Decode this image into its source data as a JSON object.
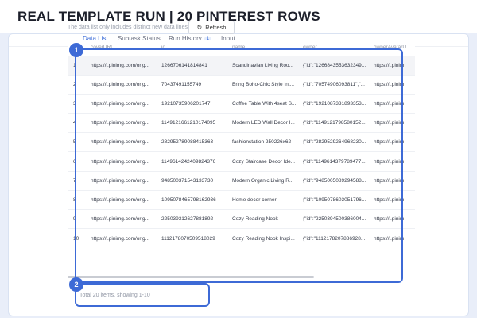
{
  "banner": {
    "title": "REAL TEMPLATE RUN  |  20 PINTEREST ROWS"
  },
  "tabs": [
    {
      "label": "Data List",
      "active": true
    },
    {
      "label": "Subtask Status",
      "active": false
    },
    {
      "label": "Run History",
      "active": false,
      "badge": "1"
    },
    {
      "label": "Input",
      "active": false
    }
  ],
  "toolbar": {
    "info": "The data list only includes distinct new data lines",
    "refresh_label": "Refresh",
    "refresh_icon": "refresh-icon"
  },
  "table": {
    "headers": [
      "#",
      "coverURL",
      "id",
      "name",
      "owner",
      "ownerAvatarU"
    ],
    "rows": [
      [
        "1",
        "https://i.pinimg.com/orig...",
        "1266706141814841",
        "Scandinavian Living Roo...",
        "{\"id\":\"1266843553632349...",
        "https://i.pinim"
      ],
      [
        "2",
        "https://i.pinimg.com/orig...",
        "70437491155749",
        "Bring Boho-Chic Style Int...",
        "{\"id\":\"70574906093811\",\"...",
        "https://i.pinim"
      ],
      [
        "3",
        "https://i.pinimg.com/orig...",
        "19210735906201747",
        "Coffee Table With 4seat S...",
        "{\"id\":\"1921087331893353...",
        "https://i.pinim"
      ],
      [
        "4",
        "https://i.pinimg.com/orig...",
        "1149121661210174095",
        "Modern LED Wall Decor I...",
        "{\"id\":\"1149121798580152...",
        "https://i.pinim"
      ],
      [
        "5",
        "https://i.pinimg.com/orig...",
        "282952789088415363",
        "fashionstation 250226x62",
        "{\"id\":\"2829529264968230...",
        "https://i.pinim"
      ],
      [
        "6",
        "https://i.pinimg.com/orig...",
        "1149614242409824376",
        "Cozy Staircase Decor Ide...",
        "{\"id\":\"1149614379789477...",
        "https://i.pinim"
      ],
      [
        "7",
        "https://i.pinimg.com/orig...",
        "948500371543133730",
        "Modern Organic Living R...",
        "{\"id\":\"9485005089294588...",
        "https://i.pinim"
      ],
      [
        "8",
        "https://i.pinimg.com/orig...",
        "1095078465798162936",
        "Home decor corner",
        "{\"id\":\"1095078603051796...",
        "https://i.pinim"
      ],
      [
        "9",
        "https://i.pinimg.com/orig...",
        "225039312627881892",
        "Cozy Reading Nook",
        "{\"id\":\"2250394500386004...",
        "https://i.pinim"
      ],
      [
        "10",
        "https://i.pinimg.com/orig...",
        "1112178070509518029",
        "Cozy Reading Nook Inspi...",
        "{\"id\":\"1112178207886928...",
        "https://i.pinim"
      ]
    ]
  },
  "footer": {
    "summary": "Total 20 items,  showing 1-10"
  },
  "annotations": [
    {
      "label": "1"
    },
    {
      "label": "2"
    }
  ],
  "colors": {
    "accent": "#3d6ad6",
    "active_tab": "#3a6bd8",
    "backdrop": "#e9eef9"
  }
}
